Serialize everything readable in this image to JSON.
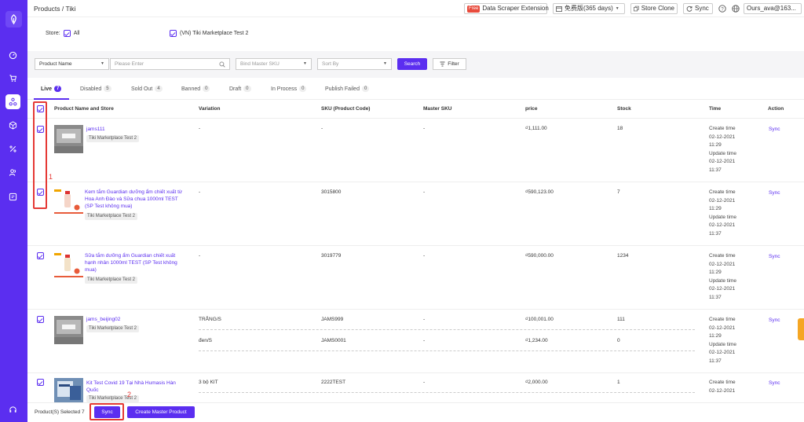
{
  "breadcrumb": "Products / Tiki",
  "topbar": {
    "free_badge": "Free",
    "scraper": "Data Scraper Extension",
    "plan": "免费版(365 days)",
    "store_clone": "Store Clone",
    "sync": "Sync",
    "user": "Ours_ava@163..."
  },
  "store_filter": {
    "label": "Store:",
    "all": "All",
    "store": "(VN) Tiki Marketplace Test 2"
  },
  "filters": {
    "field": "Product Name",
    "search_placeholder": "Please Enter",
    "bind_placeholder": "Bind Master SKU",
    "sort_placeholder": "Sort By",
    "search_btn": "Search",
    "filter_btn": "Filter"
  },
  "tabs": [
    {
      "label": "Live",
      "count": "7"
    },
    {
      "label": "Disabled",
      "count": "5"
    },
    {
      "label": "Sold Out",
      "count": "4"
    },
    {
      "label": "Banned",
      "count": "0"
    },
    {
      "label": "Draft",
      "count": "0"
    },
    {
      "label": "In Process",
      "count": "0"
    },
    {
      "label": "Publish Failed",
      "count": "0"
    }
  ],
  "columns": {
    "product": "Product Name and Store",
    "variation": "Variation",
    "sku": "SKU (Product Code)",
    "master": "Master SKU",
    "price": "price",
    "stock": "Stock",
    "time": "Time",
    "action": "Action"
  },
  "rows": [
    {
      "name": "jams111",
      "store": "Tiki Marketplace Test 2",
      "variation": "-",
      "sku": "-",
      "master": "-",
      "price": "₫1,111.00",
      "stock": "18",
      "create_label": "Create time",
      "create": "02-12-2021 11:29",
      "update_label": "Update time",
      "update": "02-12-2021 11:37",
      "action": "Sync"
    },
    {
      "name": "Kem tắm Guardian dưỡng ẩm chiết xuất từ Hoa Anh Đào và Sữa chua 1000ml TEST (SP Test không mua)",
      "store": "Tiki Marketplace Test 2",
      "variation": "-",
      "sku": "3015800",
      "master": "-",
      "price": "₫590,123.00",
      "stock": "7",
      "create_label": "Create time",
      "create": "02-12-2021 11:29",
      "update_label": "Update time",
      "update": "02-12-2021 11:37",
      "action": "Sync"
    },
    {
      "name": "Sữa tắm dưỡng ẩm Guardian chiết xuất hạnh nhân 1000ml TEST (SP Test không mua)",
      "store": "Tiki Marketplace Test 2",
      "variation": "-",
      "sku": "3019779",
      "master": "-",
      "price": "₫590,000.00",
      "stock": "1234",
      "create_label": "Create time",
      "create": "02-12-2021 11:29",
      "update_label": "Update time",
      "update": "02-12-2021 11:37",
      "action": "Sync"
    },
    {
      "name": "jams_beijing02",
      "store": "Tiki Marketplace Test 2",
      "variations": [
        {
          "variation": "TRẮNG/S",
          "sku": "JAMS999",
          "master": "-",
          "price": "₫100,001.00",
          "stock": "111"
        },
        {
          "variation": "đen/S",
          "sku": "JAMS0001",
          "master": "-",
          "price": "₫1,234.00",
          "stock": "0"
        }
      ],
      "create_label": "Create time",
      "create": "02-12-2021 11:29",
      "update_label": "Update time",
      "update": "02-12-2021 11:37",
      "action": "Sync"
    },
    {
      "name": "Kit Test Covid 19 Tại Nhà Humasis Hàn Quốc",
      "store": "Tiki Marketplace Test 2",
      "variation": "3 bộ KIT",
      "sku": "2222TEST",
      "master": "-",
      "price": "₫2,000.00",
      "stock": "1",
      "create_label": "Create time",
      "create": "02-12-2021",
      "action": "Sync"
    }
  ],
  "bottom": {
    "selected": "Product(S) Selected 7",
    "sync": "Sync",
    "create_master": "Create Master Product"
  },
  "annotations": {
    "one": "1",
    "two": "2"
  },
  "colors": {
    "brand": "#5b2ef0",
    "annotation": "#e53935",
    "free": "#e84b3c"
  }
}
